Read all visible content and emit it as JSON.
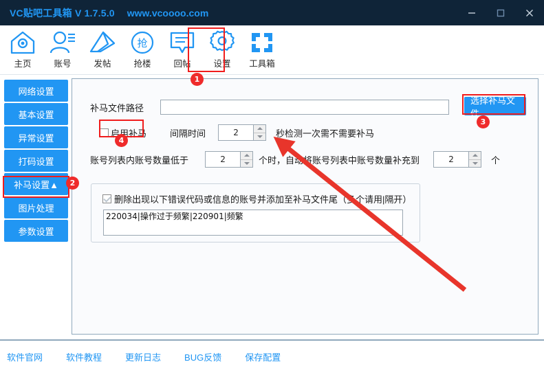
{
  "window": {
    "title": "VC贴吧工具箱 V 1.7.5.0",
    "url": "www.vcoooo.com",
    "controls": {
      "minimize": "minimize-icon",
      "maximize": "maximize-icon",
      "close": "close-icon"
    }
  },
  "toolbar": {
    "items": [
      {
        "label": "主页",
        "icon": "home-icon"
      },
      {
        "label": "账号",
        "icon": "user-icon"
      },
      {
        "label": "发帖",
        "icon": "pencil-icon"
      },
      {
        "label": "抢楼",
        "icon": "grab-circle-icon"
      },
      {
        "label": "回帖",
        "icon": "comment-icon"
      },
      {
        "label": "设置",
        "icon": "gear-icon"
      },
      {
        "label": "工具箱",
        "icon": "grid-icon"
      }
    ],
    "active": "设置"
  },
  "sidebar": {
    "items": [
      {
        "label": "网络设置"
      },
      {
        "label": "基本设置"
      },
      {
        "label": "异常设置"
      },
      {
        "label": "打码设置"
      },
      {
        "label": "补马设置▲"
      },
      {
        "label": "图片处理"
      },
      {
        "label": "参数设置"
      }
    ],
    "active": "补马设置▲"
  },
  "main": {
    "file_path": {
      "label": "补马文件路径",
      "value": "",
      "placeholder": ""
    },
    "choose_file_button": "选择补马文件",
    "enable_checkbox": {
      "label": "启用补马",
      "checked": false
    },
    "interval": {
      "label": "间隔时间",
      "value": "2",
      "suffix": "秒检测一次需不需要补马"
    },
    "account_refill": {
      "prefix": "账号列表内账号数量低于",
      "value_low": "2",
      "middle": "个时，自动将账号列表中账号数量补充到",
      "value_target": "2",
      "suffix": "个"
    },
    "delete_group": {
      "checkbox_label": "删除出现以下错误代码或信息的账号并添加至补马文件尾（多个请用|隔开）",
      "checked": true,
      "codes_value": "220034|操作过于频繁|220901|频繁"
    }
  },
  "footer": {
    "links": [
      "软件官网",
      "软件教程",
      "更新日志",
      "BUG反馈",
      "保存配置"
    ]
  },
  "annotations": {
    "badges": [
      {
        "number": "1"
      },
      {
        "number": "2"
      },
      {
        "number": "3"
      },
      {
        "number": "4"
      }
    ],
    "highlight_color": "#f01c1c",
    "arrow_color": "#e8352b"
  },
  "colors": {
    "titlebar_bg": "#0f2438",
    "accent": "#2196f3",
    "panel_bg": "#fafbfd",
    "panel_border": "#8fa8bc"
  }
}
